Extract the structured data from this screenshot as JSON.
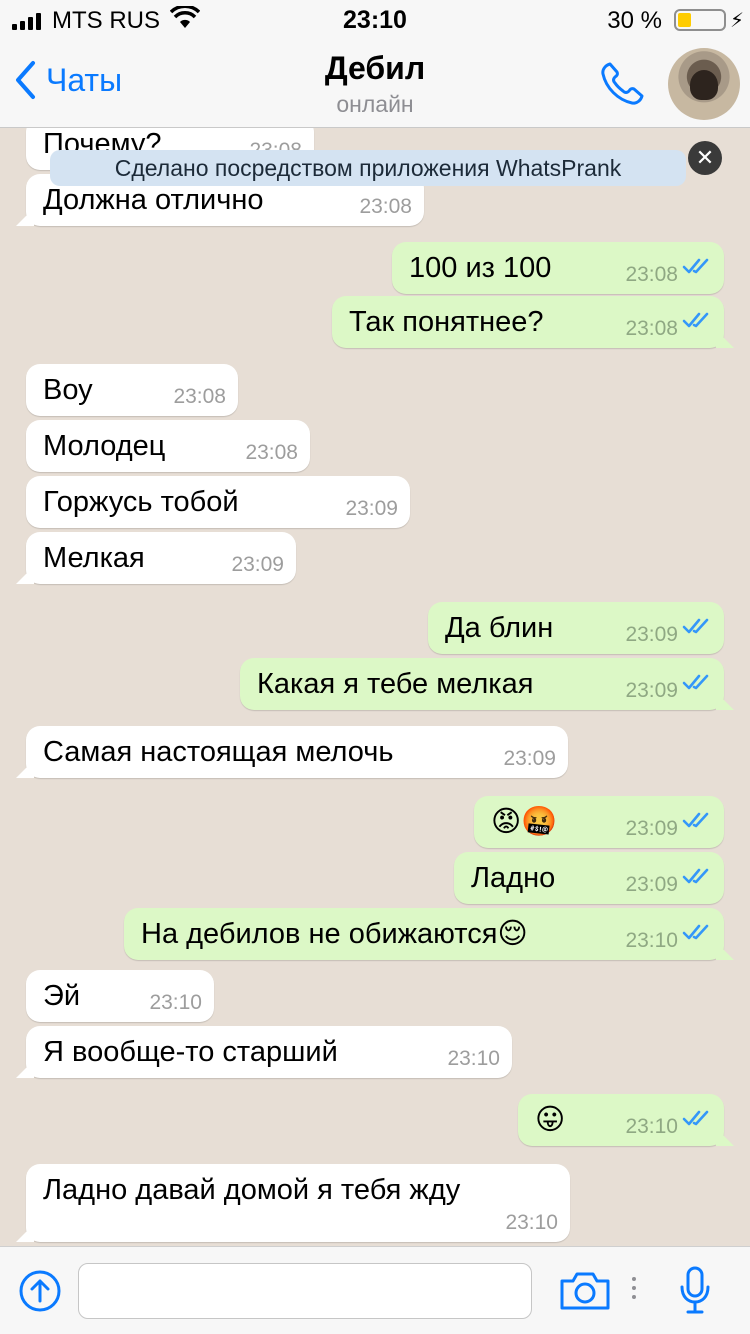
{
  "status_bar": {
    "carrier": "MTS RUS",
    "time": "23:10",
    "battery_percent": "30 %",
    "battery_level": 0.3,
    "icons": [
      "signal-icon",
      "wifi-icon",
      "battery-icon",
      "charging-bolt-icon"
    ]
  },
  "header": {
    "back_label": "Чаты",
    "contact_name": "Дебил",
    "contact_status": "онлайн",
    "icons": [
      "chevron-left-icon",
      "phone-icon",
      "avatar"
    ]
  },
  "banner": {
    "text": "Сделано посредством приложения WhatsPrank",
    "close_icon": "close-icon"
  },
  "messages": [
    {
      "dir": "in",
      "text": "Почему?",
      "time": "23:08"
    },
    {
      "dir": "in",
      "text": "Должна отлично",
      "time": "23:08"
    },
    {
      "dir": "out",
      "text": "100 из 100",
      "time": "23:08"
    },
    {
      "dir": "out",
      "text": "Так понятнее?",
      "time": "23:08"
    },
    {
      "dir": "in",
      "text": "Воу",
      "time": "23:08"
    },
    {
      "dir": "in",
      "text": "Молодец",
      "time": "23:08"
    },
    {
      "dir": "in",
      "text": "Горжусь тобой",
      "time": "23:09"
    },
    {
      "dir": "in",
      "text": "Мелкая",
      "time": "23:09"
    },
    {
      "dir": "out",
      "text": "Да блин",
      "time": "23:09"
    },
    {
      "dir": "out",
      "text": "Какая я тебе мелкая",
      "time": "23:09"
    },
    {
      "dir": "in",
      "text": "Самая настоящая мелочь",
      "time": "23:09"
    },
    {
      "dir": "out",
      "text": "😡🤬",
      "time": "23:09"
    },
    {
      "dir": "out",
      "text": "Ладно",
      "time": "23:09"
    },
    {
      "dir": "out",
      "text": "На дебилов не обижаются😌",
      "time": "23:10"
    },
    {
      "dir": "in",
      "text": "Эй",
      "time": "23:10"
    },
    {
      "dir": "in",
      "text": "Я вообще-то старший",
      "time": "23:10"
    },
    {
      "dir": "out",
      "text": "😛",
      "time": "23:10"
    },
    {
      "dir": "in",
      "text": "Ладно давай домой я тебя жду",
      "time": "23:10"
    }
  ],
  "input_bar": {
    "placeholder": "",
    "icons": [
      "attach-icon",
      "camera-icon",
      "more-dots-icon",
      "microphone-icon"
    ]
  },
  "colors": {
    "accent": "#0a7aff",
    "incoming_bubble": "#ffffff",
    "outgoing_bubble": "#dcf8c6",
    "read_ticks": "#3497f9",
    "chat_background": "#e7ded5"
  }
}
